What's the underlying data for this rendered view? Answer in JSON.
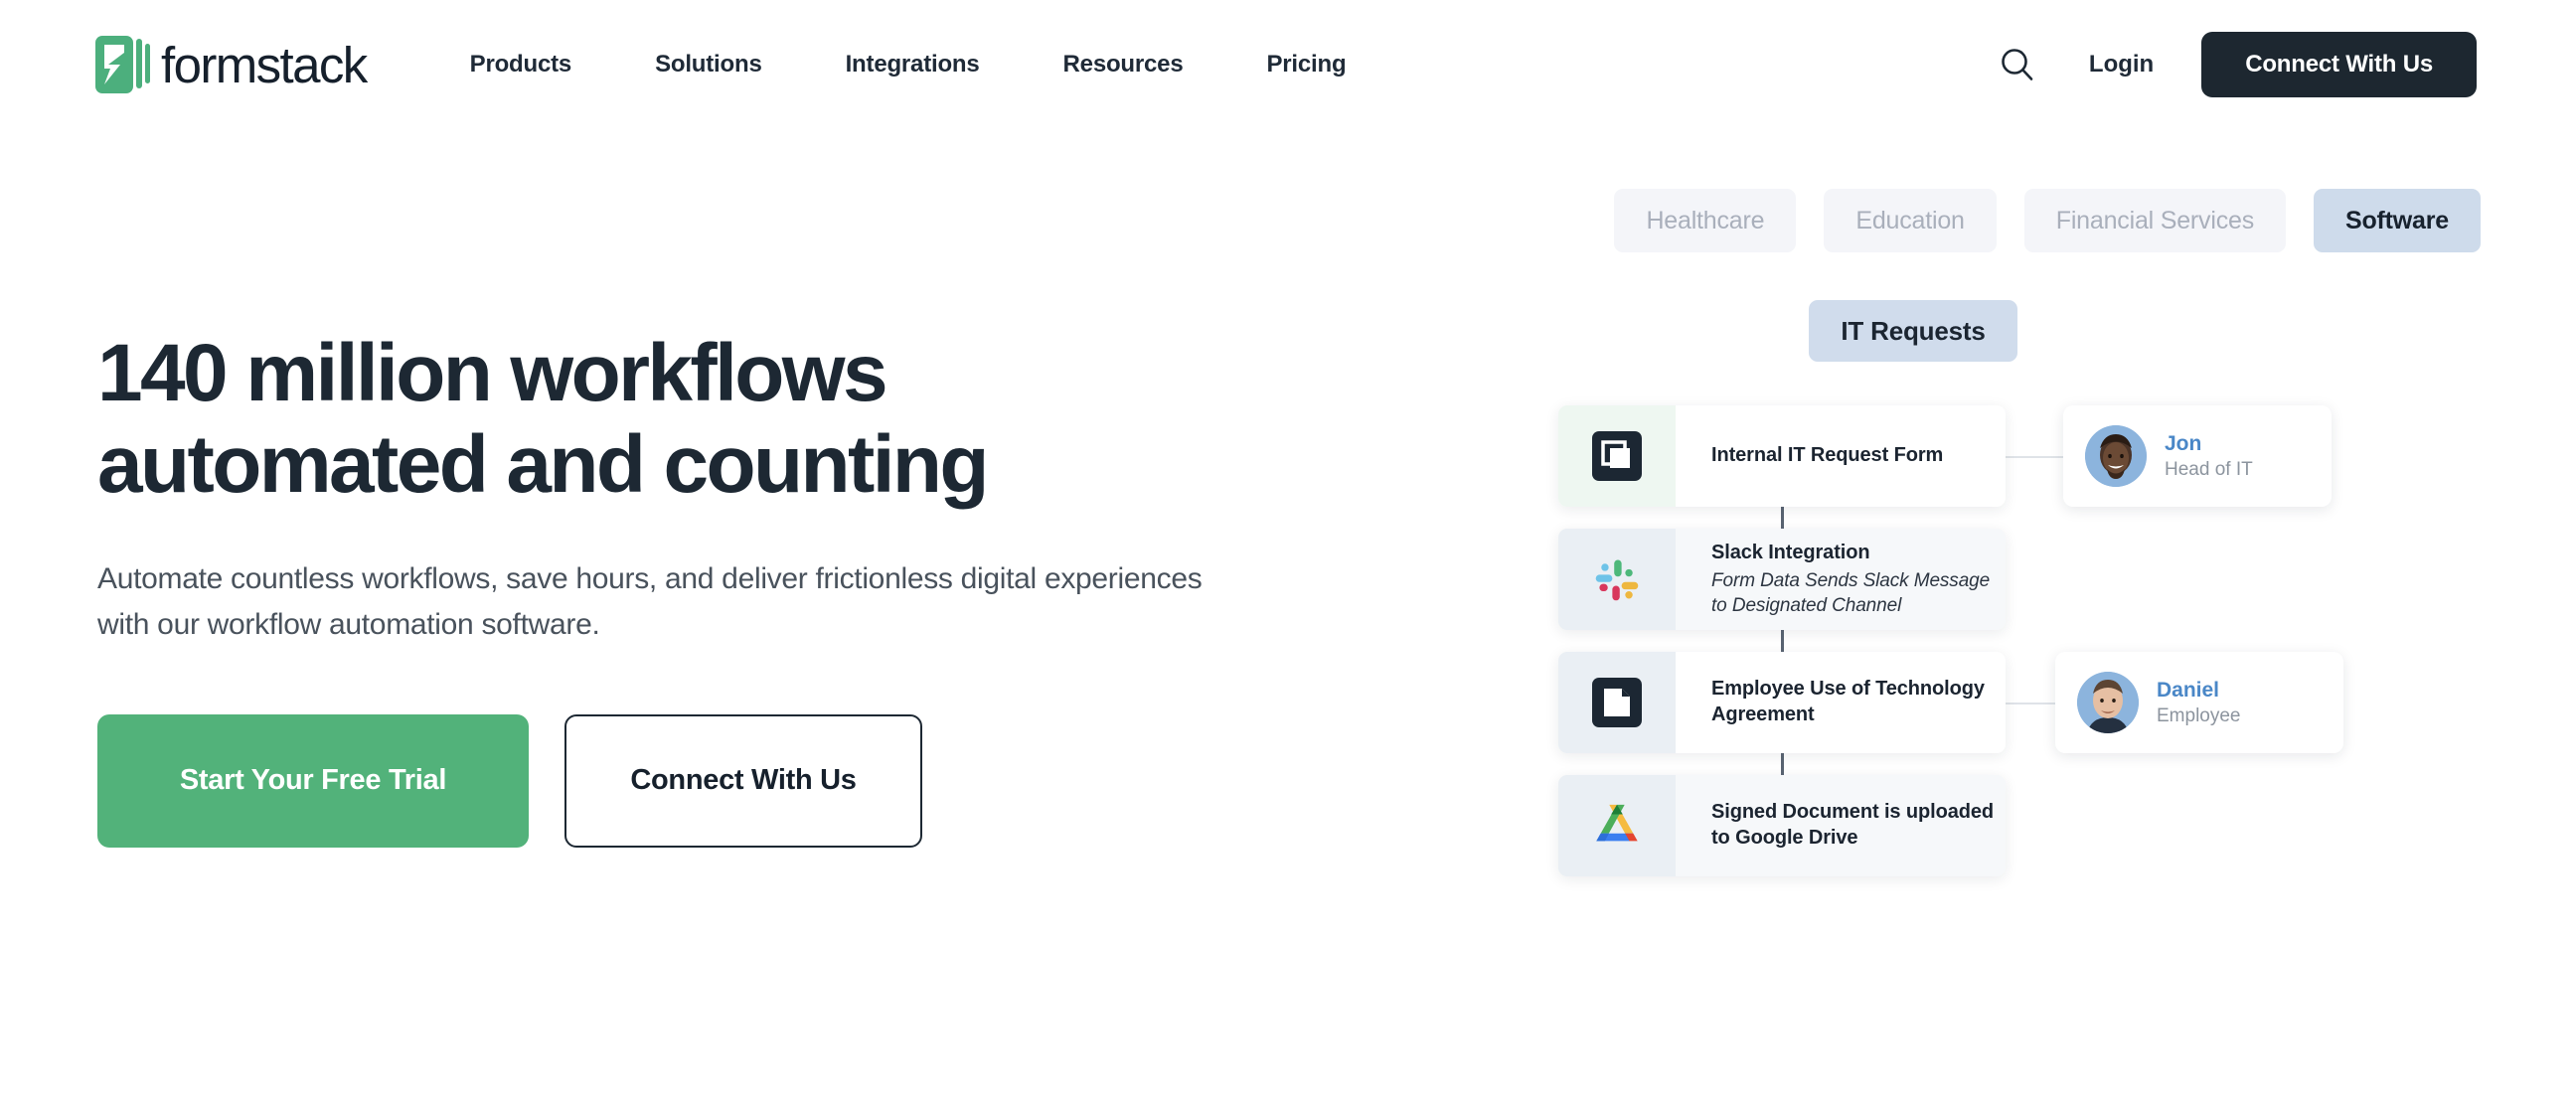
{
  "header": {
    "brand_word": "formstack",
    "brand_logo_icon": "formstack-lightning-logo",
    "nav": [
      {
        "label": "Products"
      },
      {
        "label": "Solutions"
      },
      {
        "label": "Integrations"
      },
      {
        "label": "Resources"
      },
      {
        "label": "Pricing"
      }
    ],
    "search_icon": "search-icon",
    "login_label": "Login",
    "connect_label": "Connect With Us"
  },
  "hero": {
    "title": "140 million workflows automated and counting",
    "subtitle": "Automate countless workflows, save hours, and deliver frictionless digital experiences with our workflow automation software.",
    "primary_cta": "Start Your Free Trial",
    "secondary_cta": "Connect With Us"
  },
  "industry_pills": [
    {
      "label": "Healthcare",
      "active": false
    },
    {
      "label": "Education",
      "active": false
    },
    {
      "label": "Financial Services",
      "active": false
    },
    {
      "label": "Software",
      "active": true
    }
  ],
  "workflow": {
    "section_label": "IT Requests",
    "steps": [
      {
        "title": "Internal IT Request Form",
        "desc": "",
        "icon": "formstack-forms-icon",
        "icon_tile_color": "#eef7f1",
        "card_tinted": false
      },
      {
        "title": "Slack Integration",
        "desc": "Form Data Sends Slack Message to Designated Channel",
        "icon": "slack-icon",
        "icon_tile_color": "#eaeff4",
        "card_tinted": true
      },
      {
        "title": "Employee Use of Technology Agreement",
        "desc": "",
        "icon": "formstack-documents-icon",
        "icon_tile_color": "#eaeff4",
        "card_tinted": false
      },
      {
        "title": "Signed Document is uploaded to Google Drive",
        "desc": "",
        "icon": "google-drive-icon",
        "icon_tile_color": "#eaeff4",
        "card_tinted": true
      }
    ],
    "people": [
      {
        "name": "Jon",
        "role": "Head of IT",
        "avatar": "avatar-jon"
      },
      {
        "name": "Daniel",
        "role": "Employee",
        "avatar": "avatar-daniel"
      }
    ]
  },
  "colors": {
    "brand_green": "#4caf7d",
    "cta_green": "#52b27a",
    "dark": "#1d2730",
    "accent_blue": "#4a87c7",
    "pill_active_bg": "#cedbeb",
    "label_bg": "#d0dcec"
  }
}
